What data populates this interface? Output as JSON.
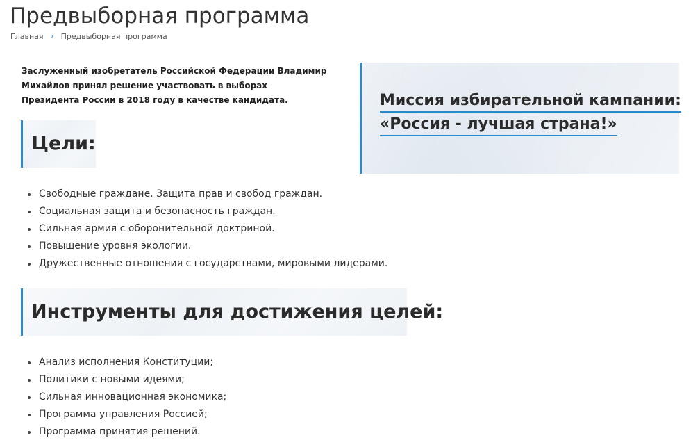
{
  "page": {
    "title": "Предвыборная программа"
  },
  "breadcrumb": {
    "home": "Главная",
    "separator": "›",
    "current": "Предвыборная программа"
  },
  "intro": "Заслуженный изобретатель Российской Федерации Владимир Михайлов принял решение участвовать в выборах Президента России в 2018 году в качестве кандидата.",
  "mission": {
    "line1": "Миссия избирательной кампании:",
    "line2": "«Россия - лучшая страна!»"
  },
  "goals": {
    "heading": "Цели:",
    "items": [
      "Свободные граждане. Защита прав и свобод граждан.",
      "Социальная защита и безопасность граждан.",
      "Сильная армия с оборонительной доктриной.",
      "Повышение уровня экологии.",
      "Дружественные отношения с государствами, мировыми лидерами."
    ]
  },
  "tools": {
    "heading": "Инструменты для достижения целей:",
    "items": [
      "Анализ исполнения Конституции;",
      "Политики с новыми идеями;",
      "Сильная инновационная экономика;",
      "Программа управления Россией;",
      "Программа принятия решений."
    ]
  },
  "colors": {
    "accent": "#2a8ac9",
    "heading_bg": "#eef2f6",
    "text": "#333333"
  }
}
